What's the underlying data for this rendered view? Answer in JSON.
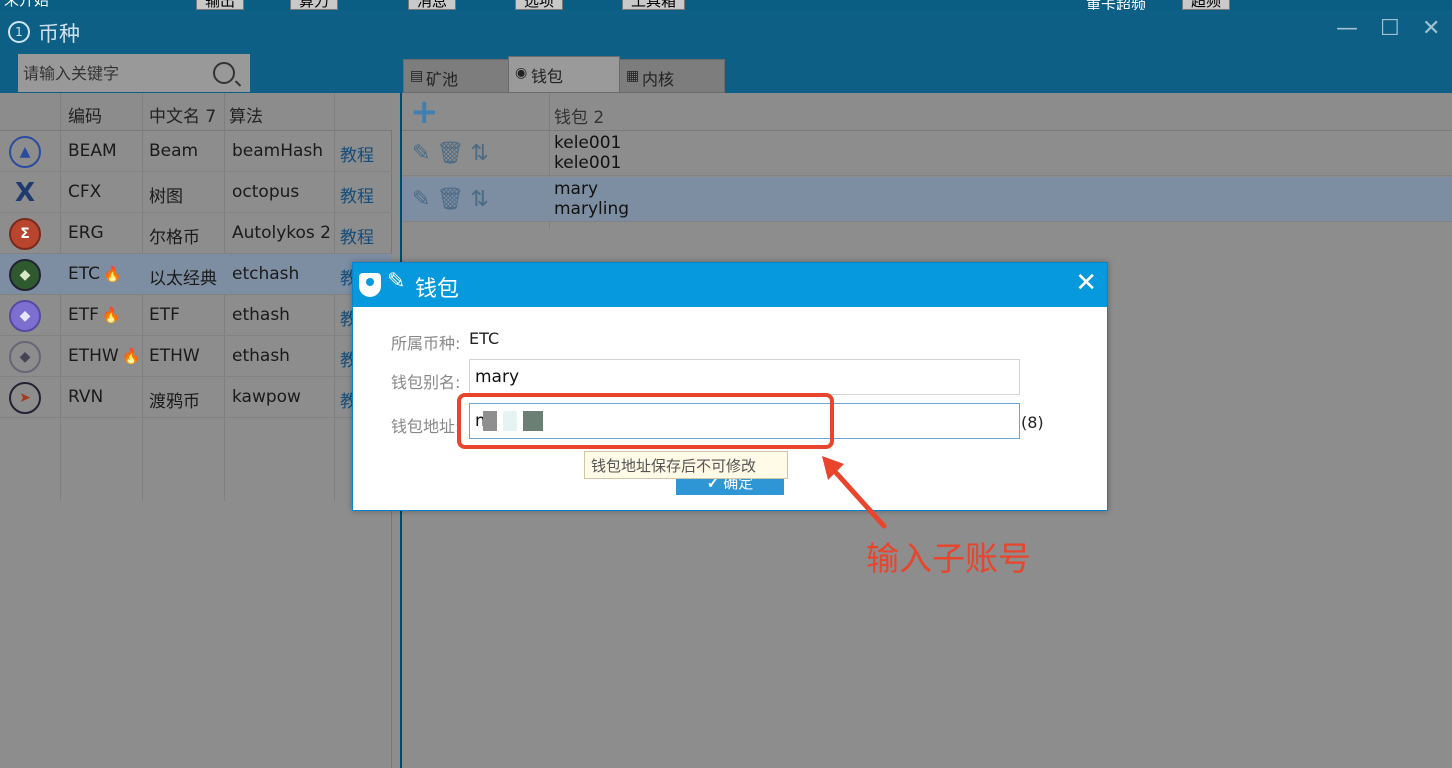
{
  "toolbar_strip": {
    "left_label": "未开始",
    "buttons": [
      "输出",
      "算力",
      "消息",
      "选项",
      "工具箱"
    ],
    "checkbox_label": "重卡超频",
    "right_button": "超频"
  },
  "window": {
    "title": "币种",
    "title_badge": "1",
    "minimize": "—",
    "maximize": "☐",
    "close": "✕"
  },
  "search": {
    "placeholder": "请输入关键字"
  },
  "coin_table": {
    "headers": {
      "code": "编码",
      "cn_name": "中文名 7",
      "algo": "算法"
    },
    "rows": [
      {
        "icon": "beam-coin-icon",
        "icon_glyph": "▲",
        "code": "BEAM",
        "cn_name": "Beam",
        "algo": "beamHash",
        "tutorial": "教程",
        "hot": false
      },
      {
        "icon": "cfx-coin-icon",
        "icon_glyph": "X",
        "code": "CFX",
        "cn_name": "树图",
        "algo": "octopus",
        "tutorial": "教程",
        "hot": false
      },
      {
        "icon": "erg-coin-icon",
        "icon_glyph": "Σ",
        "code": "ERG",
        "cn_name": "尔格币",
        "algo": "Autolykos 2",
        "tutorial": "教程",
        "hot": false
      },
      {
        "icon": "etc-coin-icon",
        "icon_glyph": "◆",
        "code": "ETC",
        "cn_name": "以太经典",
        "algo": "etchash",
        "tutorial": "教",
        "hot": true
      },
      {
        "icon": "etf-coin-icon",
        "icon_glyph": "◆",
        "code": "ETF",
        "cn_name": "ETF",
        "algo": "ethash",
        "tutorial": "教",
        "hot": true
      },
      {
        "icon": "ethw-coin-icon",
        "icon_glyph": "◆",
        "code": "ETHW",
        "cn_name": "ETHW",
        "algo": "ethash",
        "tutorial": "教",
        "hot": true
      },
      {
        "icon": "rvn-coin-icon",
        "icon_glyph": "➤",
        "code": "RVN",
        "cn_name": "渡鸦币",
        "algo": "kawpow",
        "tutorial": "教",
        "hot": false
      }
    ]
  },
  "tabs": [
    {
      "label": "矿池",
      "icon": "pool-icon",
      "glyph": "▤",
      "active": false
    },
    {
      "label": "钱包",
      "icon": "wallet-shield-icon",
      "glyph": "◉",
      "active": true
    },
    {
      "label": "内核",
      "icon": "kernel-icon",
      "glyph": "▦",
      "active": false
    }
  ],
  "wallet_table": {
    "add_glyph": "+",
    "header": "钱包 2",
    "action_glyphs": "✎🗑⇅",
    "rows": [
      {
        "line1": "kele001",
        "line2": "kele001"
      },
      {
        "line1": "mary",
        "line2": "maryling"
      }
    ]
  },
  "dialog": {
    "title": "钱包",
    "close": "✕",
    "coin_label": "所属币种:",
    "coin_value": "ETC",
    "alias_label": "钱包别名:",
    "alias_value": "mary",
    "address_label": "钱包地址:",
    "address_value": "m",
    "address_count": "(8)",
    "tooltip": "钱包地址保存后不可修改",
    "ok_label": "确定",
    "ok_glyph": "✓"
  },
  "annotation": {
    "text": "输入子账号",
    "color": "#e8452c"
  }
}
